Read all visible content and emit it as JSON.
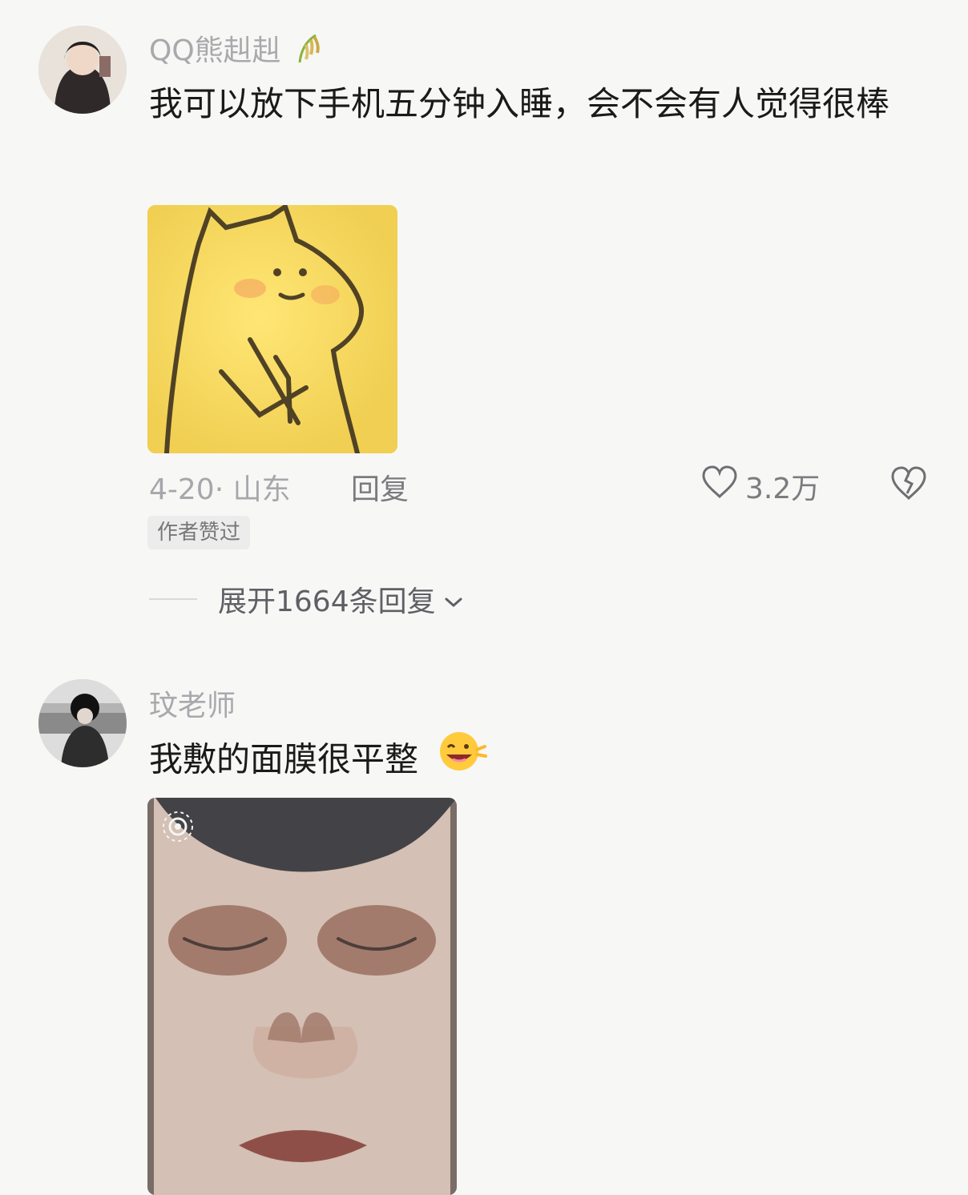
{
  "comments": [
    {
      "username": "QQ熊赳赳",
      "text": "我可以放下手机五分钟入睡，会不会有人觉得很棒",
      "date": "4-20",
      "location": "山东",
      "reply_label": "回复",
      "likes": "3.2万",
      "badge": "作者赞过",
      "expand_label": "展开1664条回复"
    },
    {
      "username": "玟老师",
      "text": "我敷的面膜很平整"
    }
  ],
  "icons": {
    "heart": "heart-icon",
    "dislike": "broken-heart-icon",
    "chevron": "chevron-down-icon",
    "rice": "rice-icon",
    "emoji": "grinning-wink-emoji"
  }
}
